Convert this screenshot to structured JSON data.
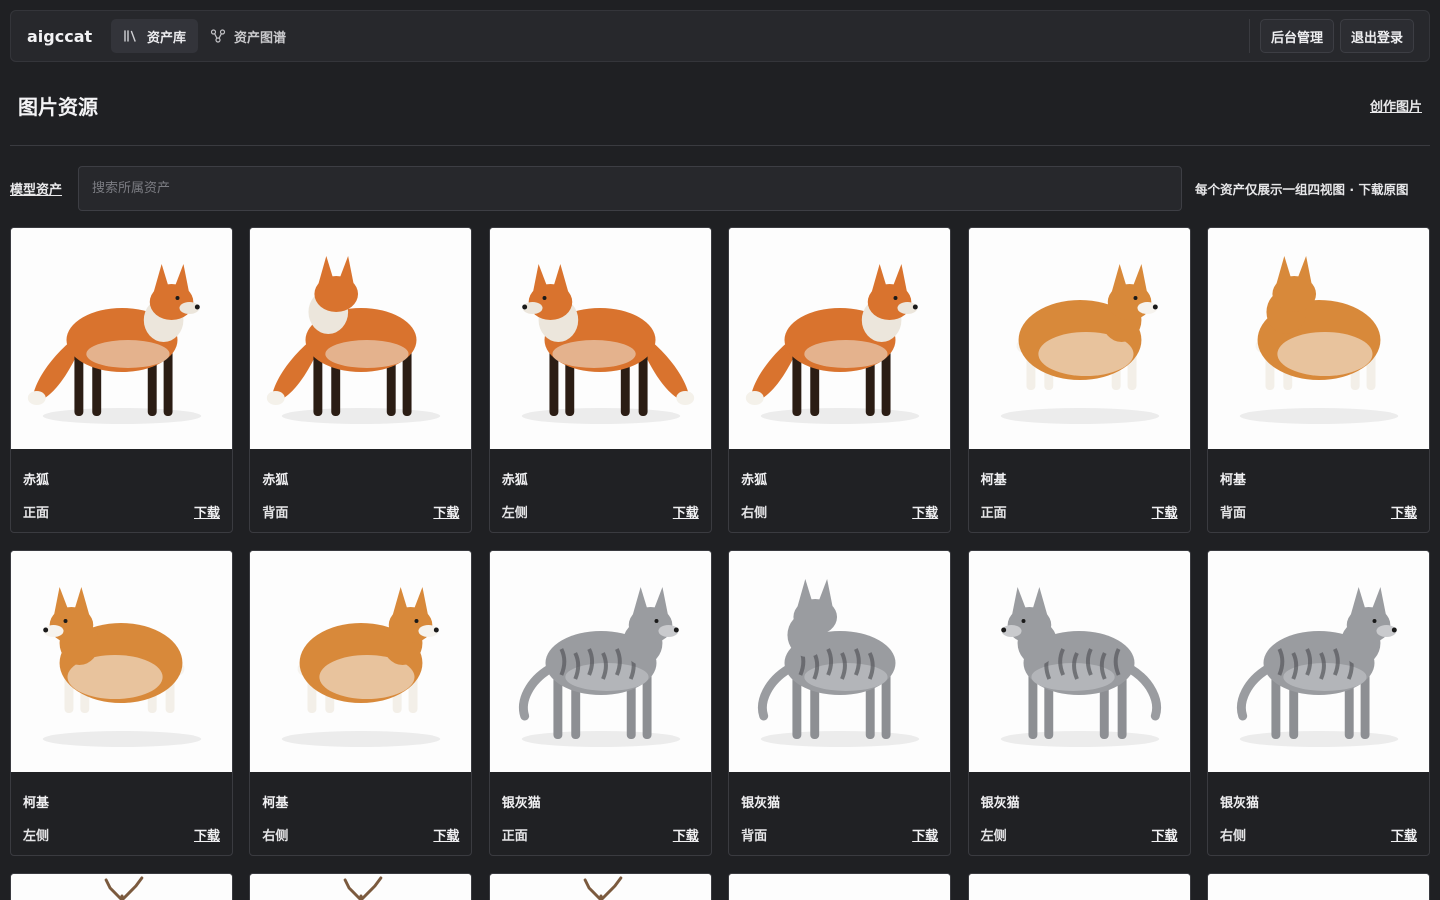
{
  "topbar": {
    "brand": "aigccat",
    "nav": [
      {
        "label": "资产库",
        "icon": "library-icon",
        "active": true
      },
      {
        "label": "资产图谱",
        "icon": "graph-icon",
        "active": false
      }
    ],
    "admin_label": "后台管理",
    "logout_label": "退出登录"
  },
  "page": {
    "title": "图片资源",
    "create_label": "创作图片"
  },
  "toolbar": {
    "model_assets_label": "模型资产",
    "search_placeholder": "搜索所属资产",
    "search_value": "",
    "hint": "每个资产仅展示一组四视图 · 下载原图"
  },
  "cards": [
    {
      "name": "赤狐",
      "view": "正面",
      "download": "下载",
      "animal": "fox",
      "pose": "front"
    },
    {
      "name": "赤狐",
      "view": "背面",
      "download": "下载",
      "animal": "fox",
      "pose": "back"
    },
    {
      "name": "赤狐",
      "view": "左侧",
      "download": "下载",
      "animal": "fox",
      "pose": "left"
    },
    {
      "name": "赤狐",
      "view": "右侧",
      "download": "下载",
      "animal": "fox",
      "pose": "right"
    },
    {
      "name": "柯基",
      "view": "正面",
      "download": "下载",
      "animal": "corgi",
      "pose": "front"
    },
    {
      "name": "柯基",
      "view": "背面",
      "download": "下载",
      "animal": "corgi",
      "pose": "back"
    },
    {
      "name": "柯基",
      "view": "左侧",
      "download": "下载",
      "animal": "corgi",
      "pose": "left"
    },
    {
      "name": "柯基",
      "view": "右侧",
      "download": "下载",
      "animal": "corgi",
      "pose": "right"
    },
    {
      "name": "银灰猫",
      "view": "正面",
      "download": "下载",
      "animal": "cat",
      "pose": "front"
    },
    {
      "name": "银灰猫",
      "view": "背面",
      "download": "下载",
      "animal": "cat",
      "pose": "back"
    },
    {
      "name": "银灰猫",
      "view": "左侧",
      "download": "下载",
      "animal": "cat",
      "pose": "left"
    },
    {
      "name": "银灰猫",
      "view": "右侧",
      "download": "下载",
      "animal": "cat",
      "pose": "right"
    }
  ],
  "partial_cards": [
    {
      "animal": "deer"
    },
    {
      "animal": "deer"
    },
    {
      "animal": "deer"
    },
    {
      "animal": "blank"
    },
    {
      "animal": "blank"
    },
    {
      "animal": "blank"
    }
  ],
  "colors": {
    "background": "#1f2023",
    "panel": "#27282c",
    "fox": "#d9732e",
    "corgi": "#d8893a",
    "cat": "#9a9ca0"
  }
}
